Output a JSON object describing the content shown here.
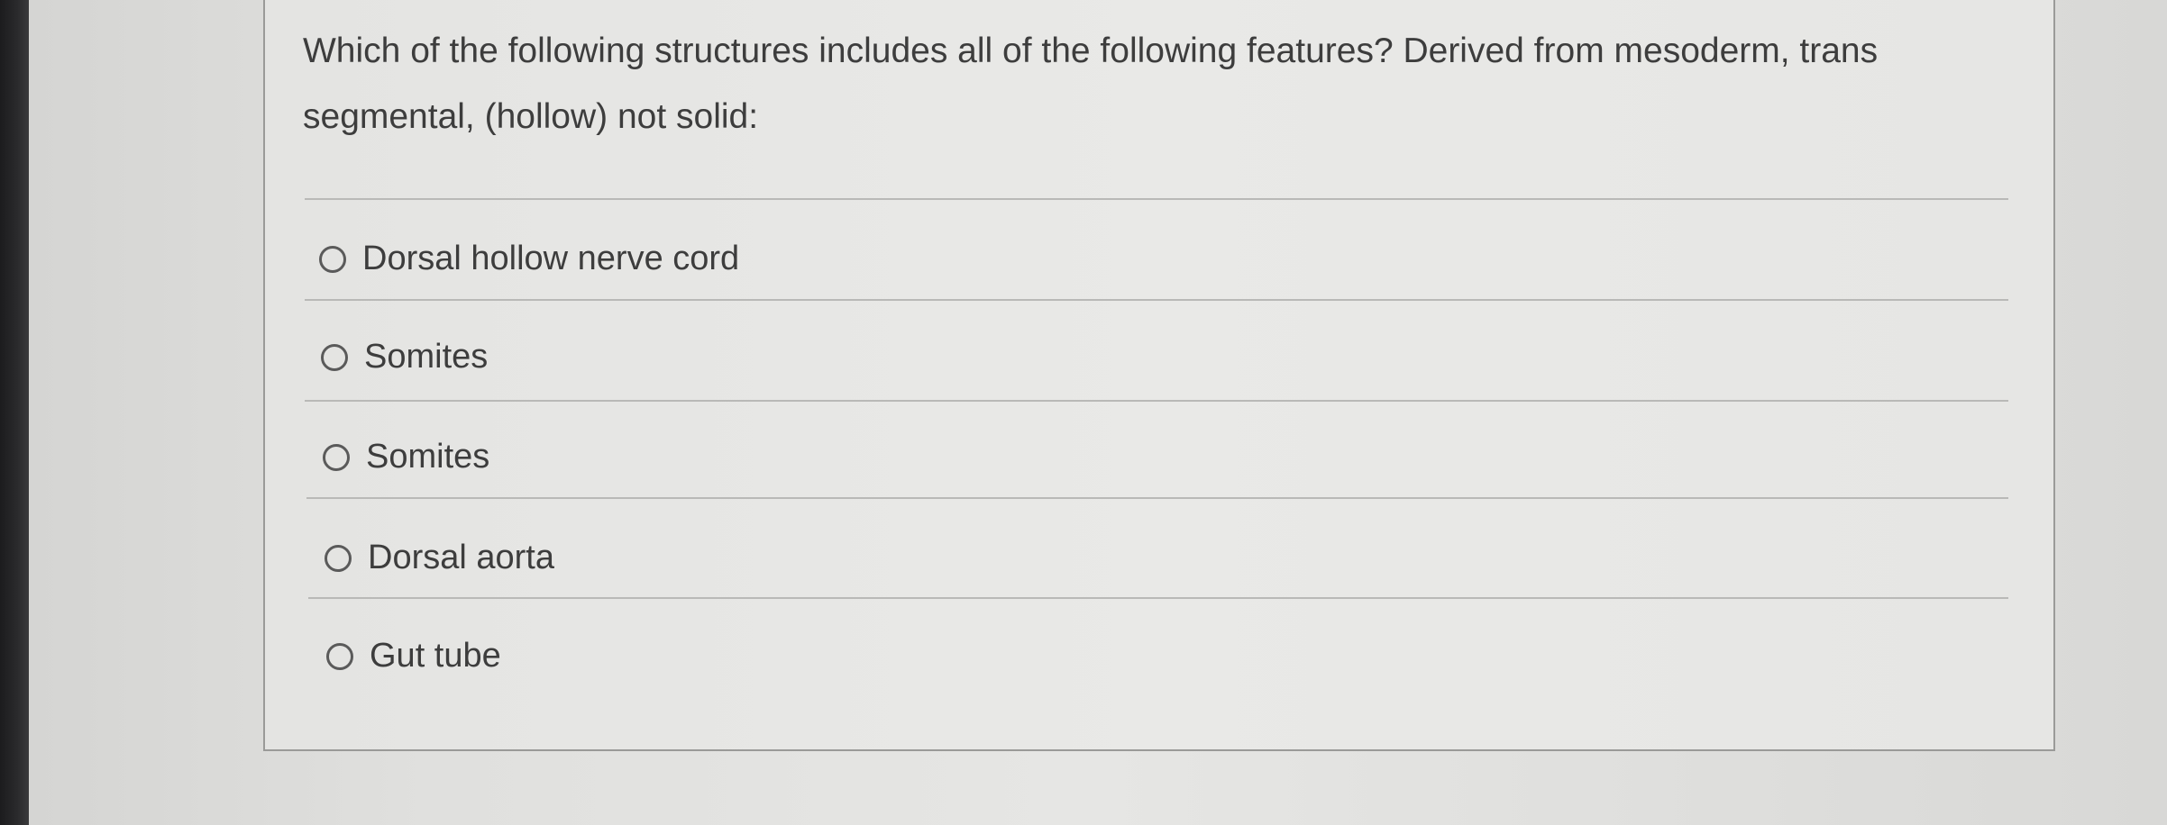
{
  "question": {
    "text": "Which of the following structures includes all of the following features?  Derived from mesoderm, trans segmental, (hollow) not solid:"
  },
  "options": [
    {
      "label": "Dorsal hollow nerve cord",
      "selected": false
    },
    {
      "label": "Somites",
      "selected": false
    },
    {
      "label": "Somites",
      "selected": false
    },
    {
      "label": "Dorsal aorta",
      "selected": false
    },
    {
      "label": "Gut tube",
      "selected": false
    }
  ]
}
